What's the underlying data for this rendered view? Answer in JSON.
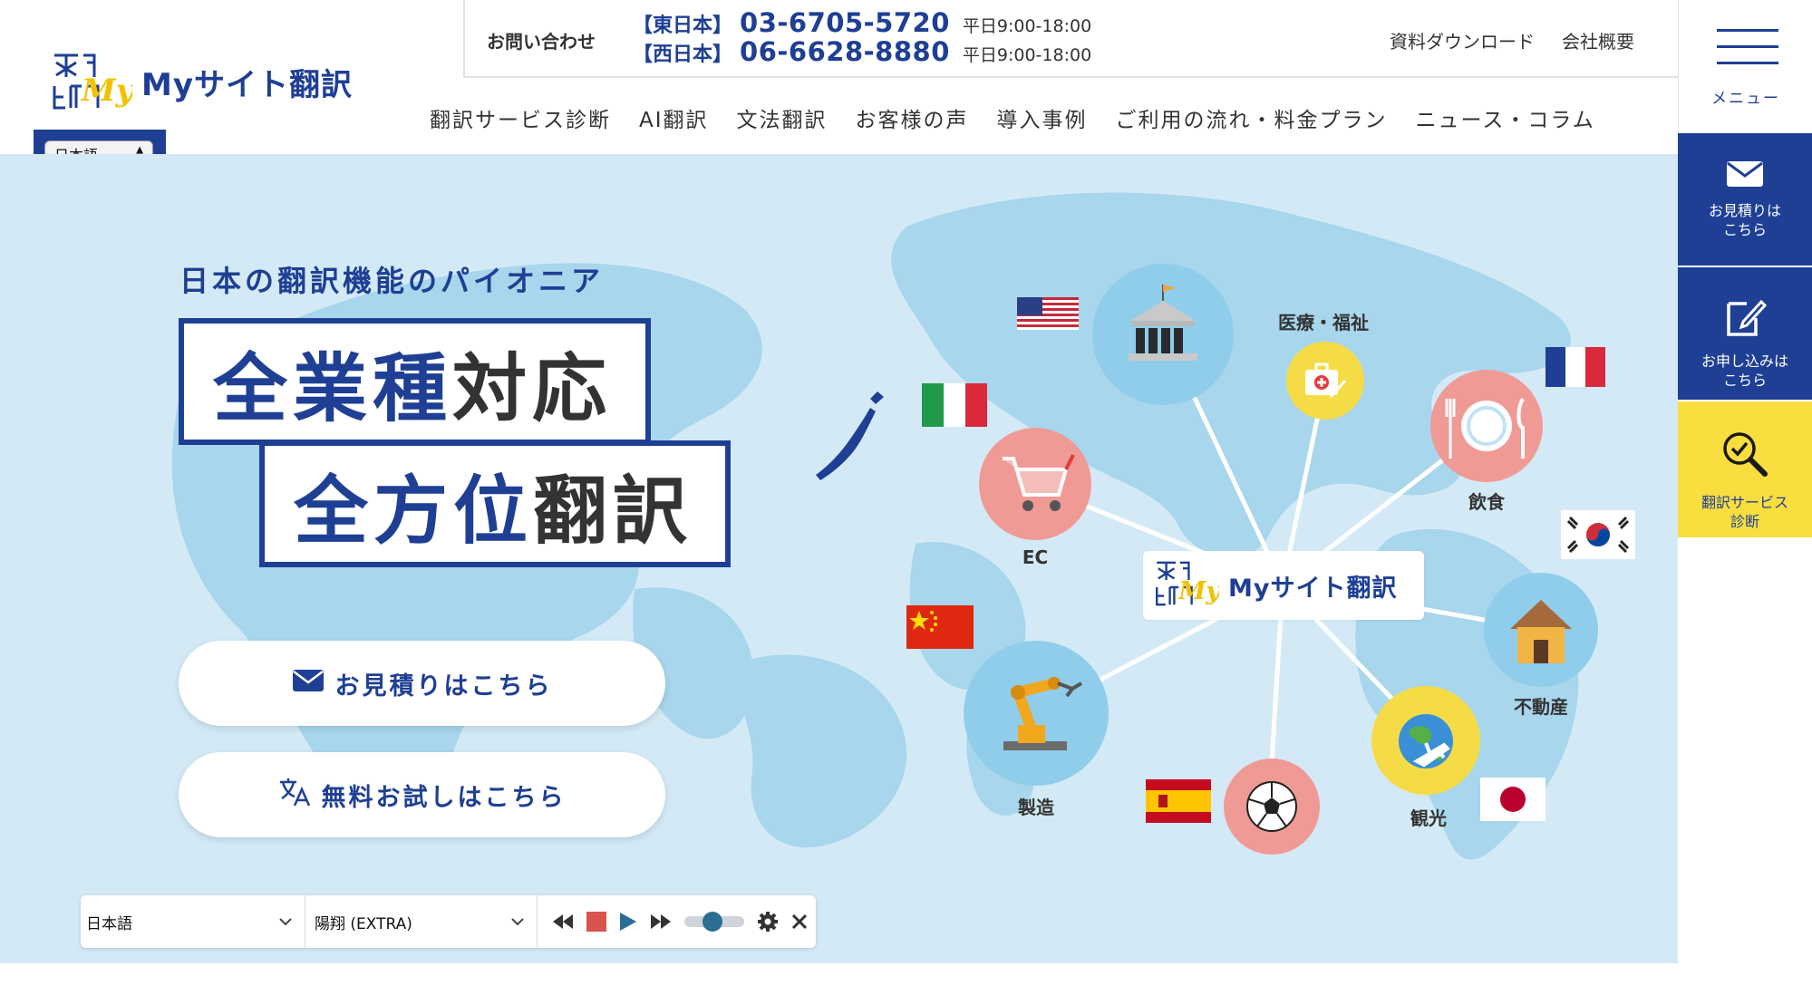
{
  "brand": {
    "name": "Myサイト翻訳",
    "mark": "My"
  },
  "language_switcher": {
    "value": "日本語"
  },
  "contact": {
    "label": "お問い合わせ",
    "east": {
      "region": "【東日本】",
      "phone": "03-6705-5720",
      "hours": "平日9:00-18:00"
    },
    "west": {
      "region": "【西日本】",
      "phone": "06-6628-8880",
      "hours": "平日9:00-18:00"
    }
  },
  "top_links": [
    "資料ダウンロード",
    "会社概要"
  ],
  "nav": [
    "翻訳サービス診断",
    "AI翻訳",
    "文法翻訳",
    "お客様の声",
    "導入事例",
    "ご利用の流れ・料金プラン",
    "ニュース・コラム"
  ],
  "side_menu": {
    "menu_label": "メニュー",
    "estimate_label": "お見積りは\nこちら",
    "apply_label": "お申し込みは\nこちら",
    "diagnosis_label": "翻訳サービス\n診断"
  },
  "hero": {
    "tagline": "日本の翻訳機能のパイオニア",
    "line1_a": "全業種",
    "line1_b": "対応",
    "line2_a": "全方位",
    "line2_b": "翻訳",
    "cta_estimate": "お見積りはこちら",
    "cta_trial": "無料お試しはこちら"
  },
  "industries": {
    "ec": "EC",
    "medical": "医療・福祉",
    "food": "飲食",
    "realestate": "不動産",
    "tourism": "観光",
    "manufacturing": "製造"
  },
  "tts_player": {
    "language": "日本語",
    "voice": "陽翔 (EXTRA)",
    "volume": 0.45
  },
  "colors": {
    "brand_blue": "#1e3f94",
    "accent_yellow": "#f9de3f",
    "hero_bg": "#d3eaf6",
    "map_land": "#a8d6ec"
  }
}
